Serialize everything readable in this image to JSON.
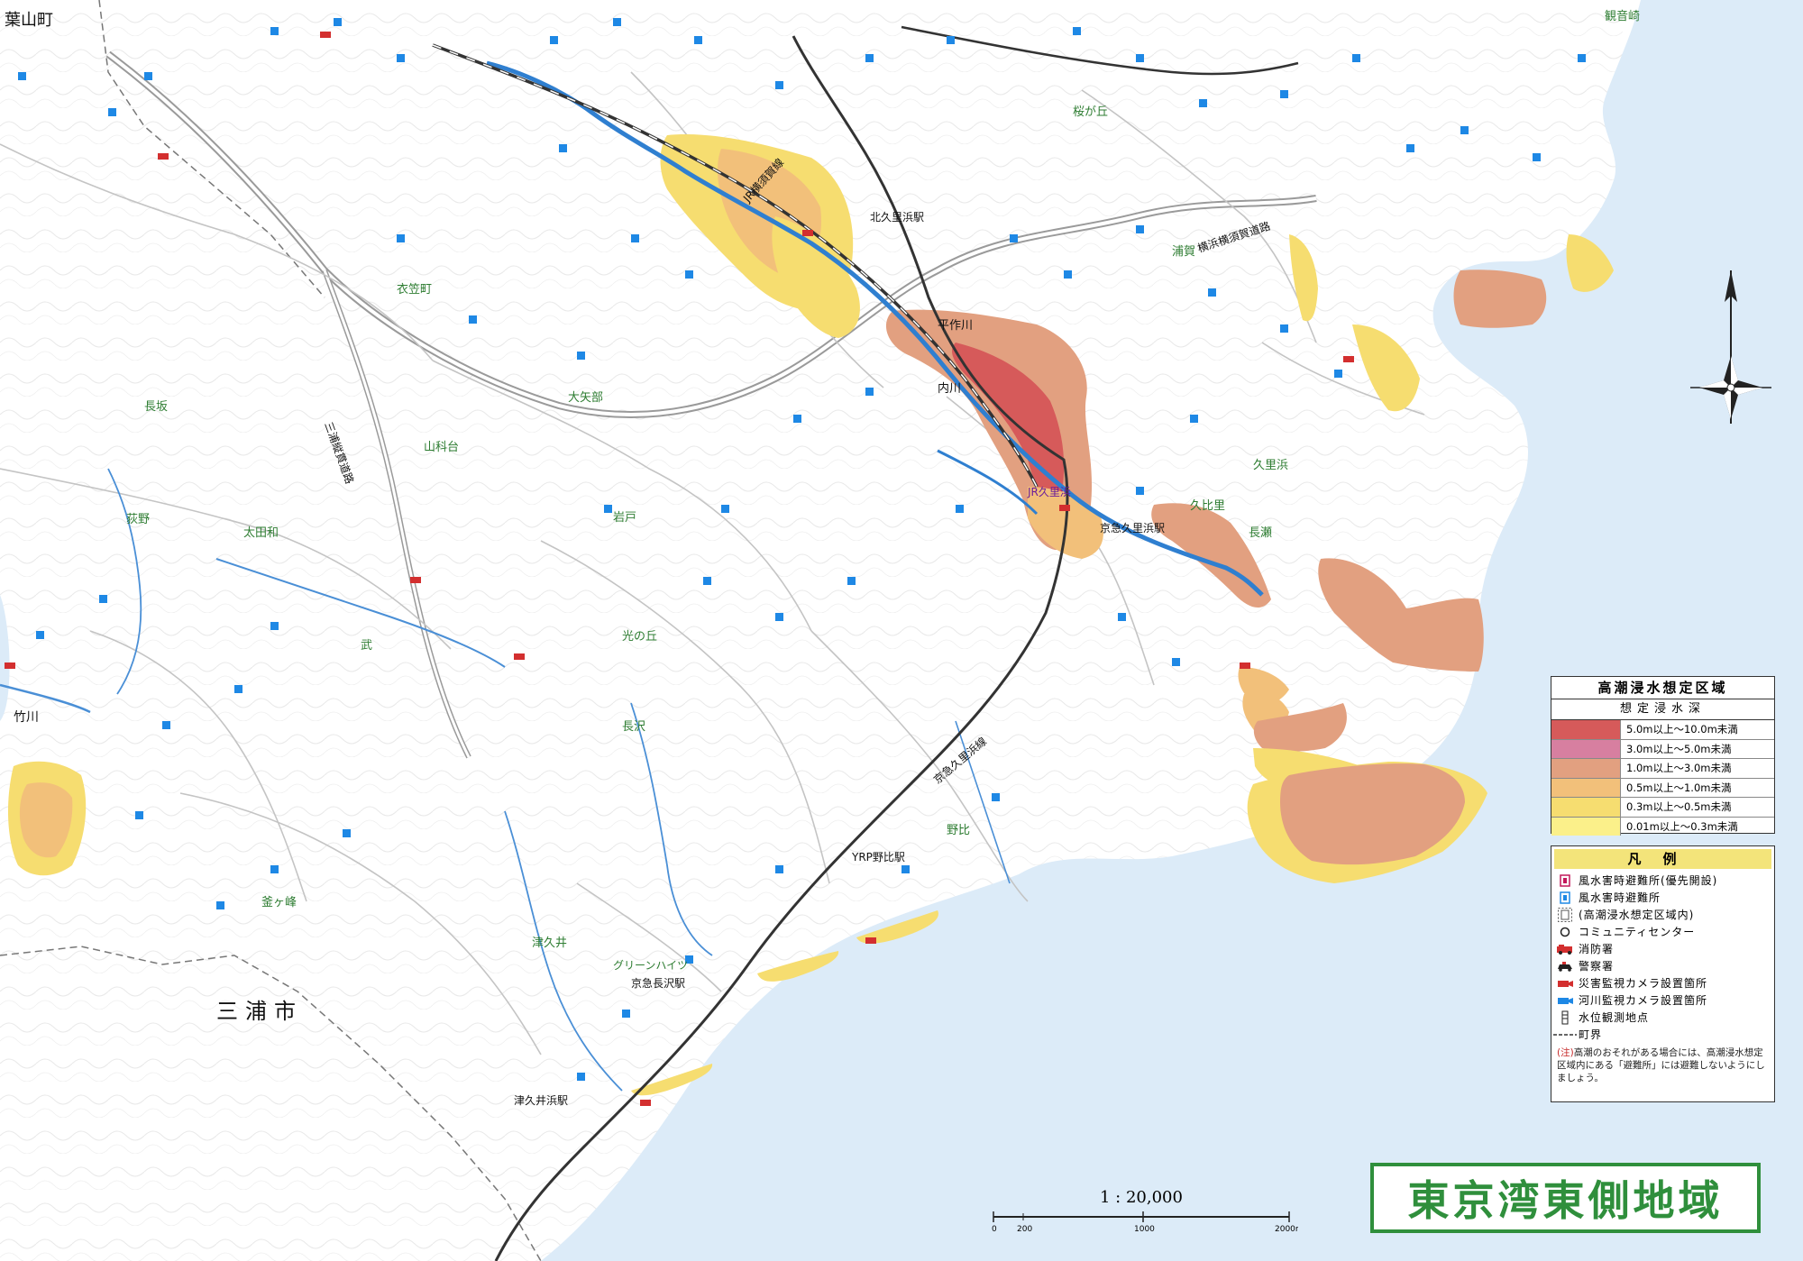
{
  "map": {
    "colors": {
      "land": "#ffffff",
      "sea": "#dcebf8",
      "river": "#2f7fd0",
      "road": "#b8b8b8",
      "rail": "#333333",
      "depth_5_10": "#d65a5a",
      "depth_3_5": "#d77fa0",
      "depth_1_3": "#e2a080",
      "depth_05_1": "#f2c07a",
      "depth_03_05": "#f6dd70",
      "depth_001_03": "#fbf08a"
    },
    "place_labels": {
      "hayama": "葉山町",
      "miura": "三浦市",
      "kinugasa": "衣笠町",
      "oyabe": "大矢部",
      "yamashina": "山科台",
      "nagasaka": "長坂",
      "ogino": "荻野",
      "ota": "太田和",
      "take": "武",
      "hikarinooka": "光の丘",
      "iwato": "岩戸",
      "sakuragaoka": "桜が丘",
      "uraga": "浦賀",
      "kurihama": "久里浜",
      "nobi": "野比",
      "tsukui": "津久井",
      "nagasawa": "長沢",
      "kuhri": "久比里",
      "nagase": "長瀬",
      "kannon": "観音崎",
      "kamagamine": "釜ヶ峰",
      "kita_kurihama_station": "北久里浜駅",
      "kurihama_station": "京急久里浜駅",
      "jr_kurihama": "JR久里浜",
      "ymp_nobi": "YRP野比駅",
      "keikyu_nagasawa": "京急長沢駅",
      "tsukuihama": "津久井浜駅",
      "hirasaku_river": "平作川",
      "uchikawa": "内川",
      "grinheights": "グリーンハイツ",
      "takeyama_river": "竹川"
    },
    "features": {
      "jr_line": "JR横須賀線",
      "keikyu_line": "京急久里浜線",
      "highway": "横浜横須賀道路",
      "miura_highway": "三浦縦貫道路"
    }
  },
  "legend_takashio": {
    "title": "高潮浸水想定区域",
    "subtitle": "想定浸水深",
    "depths": [
      {
        "label": "5.0m以上～10.0m未満",
        "color": "#d65a5a"
      },
      {
        "label": "3.0m以上～5.0m未満",
        "color": "#d77fa0"
      },
      {
        "label": "1.0m以上～3.0m未満",
        "color": "#e2a080"
      },
      {
        "label": "0.5m以上～1.0m未満",
        "color": "#f2c07a"
      },
      {
        "label": "0.3m以上～0.5m未満",
        "color": "#f6dd70"
      },
      {
        "label": "0.01m以上～0.3m未満",
        "color": "#fbf08a"
      }
    ]
  },
  "legend_hanrei": {
    "title": "凡例",
    "items": [
      {
        "icon": "priority-shelter-icon",
        "label": "風水害時避難所(優先開設)"
      },
      {
        "icon": "shelter-icon",
        "label": "風水害時避難所"
      },
      {
        "icon": "shelter-in-zone-icon",
        "label": "(高潮浸水想定区域内)"
      },
      {
        "icon": "community-center-icon",
        "label": "コミュニティセンター"
      },
      {
        "icon": "fire-station-icon",
        "label": "消防署"
      },
      {
        "icon": "police-icon",
        "label": "警察署"
      },
      {
        "icon": "disaster-camera-icon",
        "label": "災害監視カメラ設置箇所"
      },
      {
        "icon": "river-camera-icon",
        "label": "河川監視カメラ設置箇所"
      },
      {
        "icon": "water-gauge-icon",
        "label": "水位観測地点"
      },
      {
        "icon": "town-boundary-icon",
        "label": "町界"
      }
    ],
    "note_head": "(注)",
    "note": "高潮のおそれがある場合には、高潮浸水想定区域内にある「避難所」には避難しないようにしましょう。"
  },
  "scale": {
    "ratio": "1 : 20,000",
    "ticks": [
      "0",
      "200",
      "1000",
      "2000m"
    ]
  },
  "region_title": "東京湾東側地域"
}
